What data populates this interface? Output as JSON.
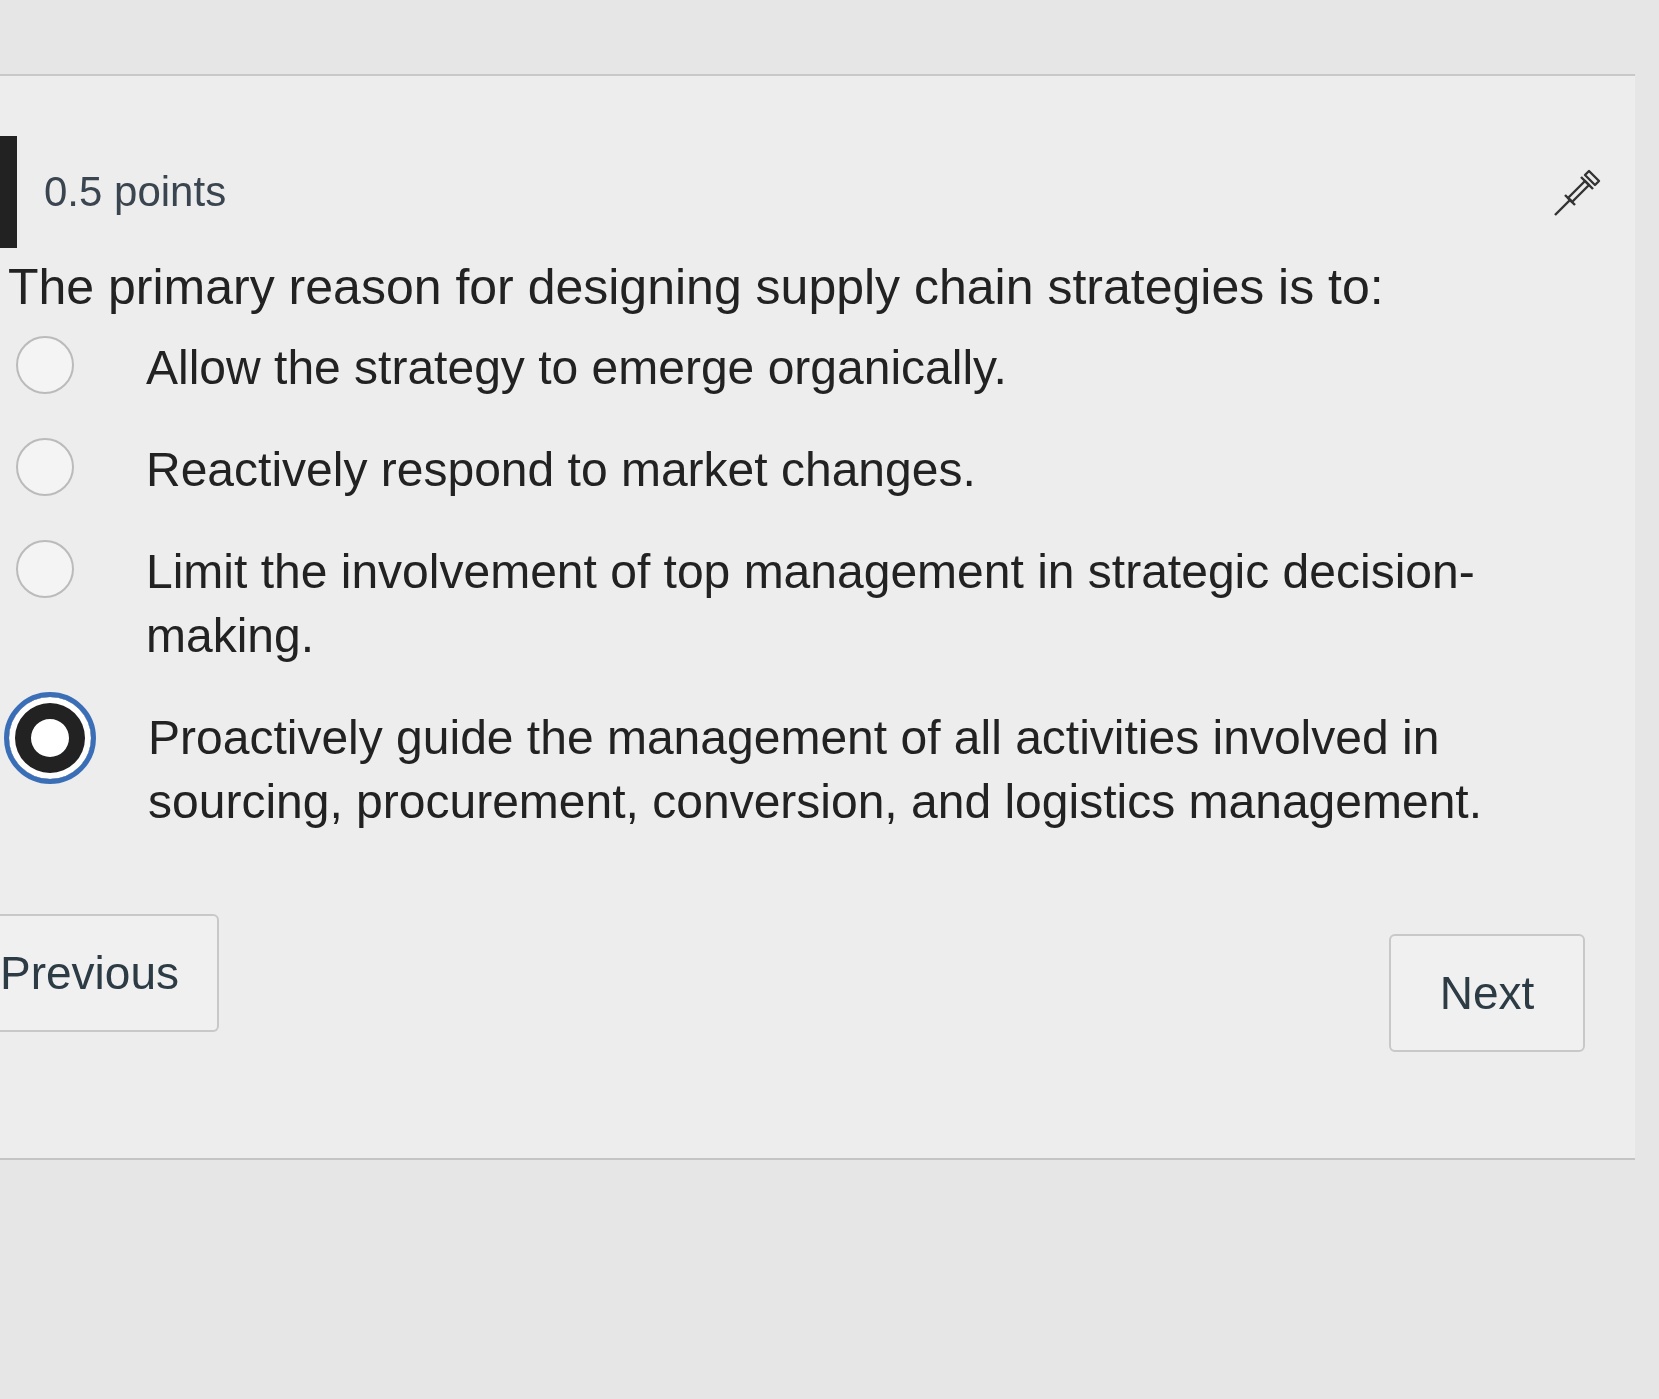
{
  "question": {
    "points": "0.5 points",
    "prompt": "The primary reason for designing supply chain strategies is to:",
    "options": [
      {
        "label": "Allow the strategy to emerge organically.",
        "selected": false
      },
      {
        "label": "Reactively respond to market changes.",
        "selected": false
      },
      {
        "label": "Limit the involvement of top management in strategic decision-making.",
        "selected": false
      },
      {
        "label": "Proactively guide the management of all activities involved in sourcing, procurement, conversion, and logistics management.",
        "selected": true
      }
    ]
  },
  "buttons": {
    "previous": "Previous",
    "next": "Next"
  }
}
